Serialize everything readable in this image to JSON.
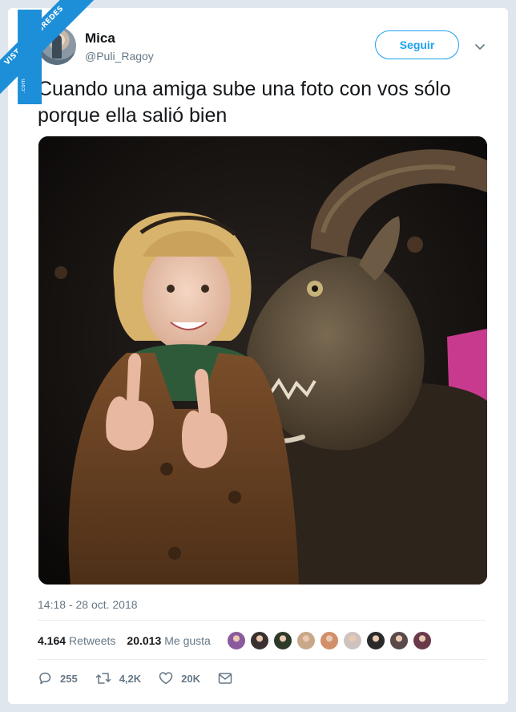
{
  "watermark": {
    "main": "VISTOENLASREDES",
    "sub": ".com"
  },
  "tweet": {
    "author_name": "Mica",
    "author_handle": "@Puli_Ragoy",
    "follow_label": "Seguir",
    "text": "Cuando una amiga sube una foto con vos sólo porque ella salió bien",
    "timestamp": "14:18 - 28 oct. 2018"
  },
  "stats": {
    "retweets_count": "4.164",
    "retweets_label": "Retweets",
    "likes_count": "20.013",
    "likes_label": "Me gusta"
  },
  "liker_avatars": [
    "#8b5a9e",
    "#3a3030",
    "#2d3a28",
    "#c9a88a",
    "#d18f6a",
    "#cfc3bf",
    "#2a2a2a",
    "#5a4a4a",
    "#6a3a4a"
  ],
  "actions": {
    "replies": "255",
    "retweets": "4,2K",
    "likes": "20K"
  },
  "colors": {
    "accent": "#1da1f2",
    "secondary_text": "#657786",
    "page_bg": "#dfe6ee"
  },
  "icons": [
    "chevron-down-icon",
    "reply-icon",
    "retweet-icon",
    "heart-icon",
    "message-icon"
  ]
}
